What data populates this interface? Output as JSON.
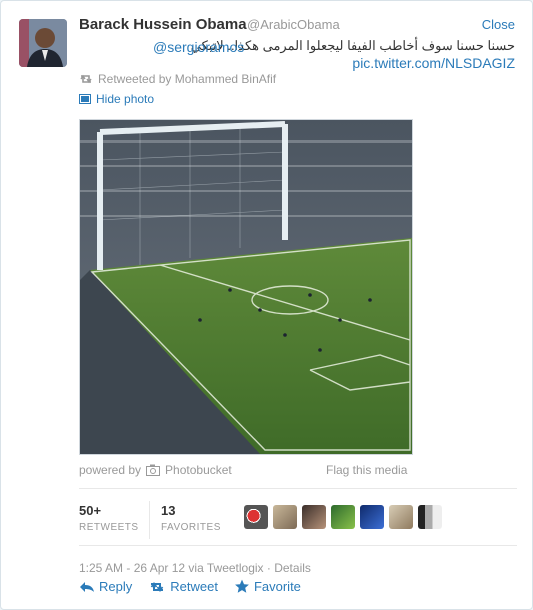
{
  "tweet": {
    "author_name": "Barack Hussein Obama",
    "author_handle": "@ArabicObama",
    "close_label": "Close",
    "text": "حسنا حسنا سوف أخاطب الفيفا ليجعلوا المرمى هكذا.. لاتبكي",
    "mention": "@sergioramos",
    "pic_link": "pic.twitter.com/NLSDAGIZ",
    "retweeted_by": "Retweeted by Mohammed BinAfif",
    "hide_photo_label": "Hide photo",
    "powered_by_label": "powered by",
    "photo_provider": "Photobucket",
    "flag_media_label": "Flag this media"
  },
  "stats": {
    "retweets_count": "50+",
    "retweets_label": "RETWEETS",
    "favorites_count": "13",
    "favorites_label": "FAVORITES"
  },
  "meta": {
    "timestamp": "1:25 AM - 26 Apr 12 via Tweetlogix · Details"
  },
  "actions": {
    "reply_label": "Reply",
    "retweet_label": "Retweet",
    "favorite_label": "Favorite"
  },
  "icons": {
    "avatar": "avatar-image",
    "retweet": "retweet-icon",
    "photo": "photo-icon",
    "camera": "camera-icon",
    "reply": "reply-icon",
    "favorite": "star-icon"
  },
  "colors": {
    "link": "#2b7bb9",
    "muted": "#999999",
    "text": "#333333",
    "star": "#2b7bb9"
  }
}
